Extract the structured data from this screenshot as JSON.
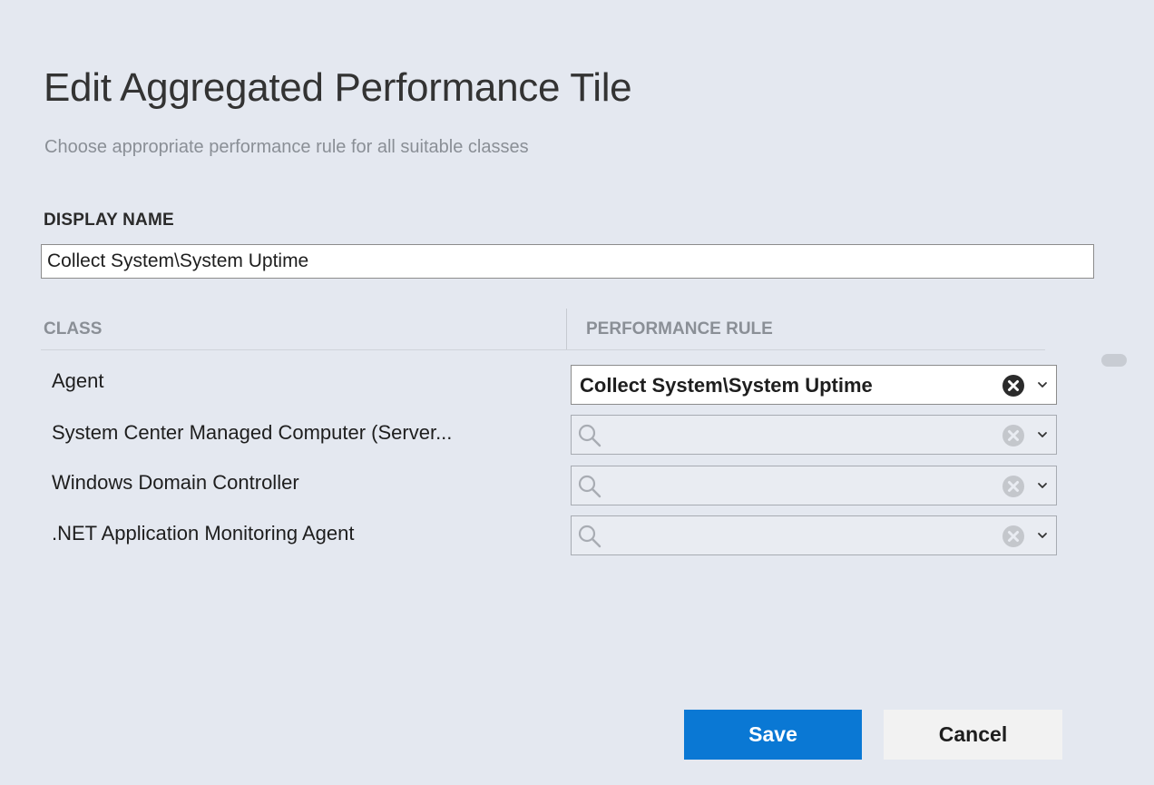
{
  "dialog": {
    "title": "Edit Aggregated Performance Tile",
    "subtitle": "Choose appropriate performance rule for all suitable classes"
  },
  "display_name": {
    "label": "DISPLAY NAME",
    "value": "Collect System\\System Uptime"
  },
  "table": {
    "col_class": "CLASS",
    "col_rule": "PERFORMANCE RULE",
    "rows": [
      {
        "class": "Agent",
        "rule": "Collect System\\System Uptime"
      },
      {
        "class": "System Center Managed Computer (Server...",
        "rule": ""
      },
      {
        "class": "Windows Domain Controller",
        "rule": ""
      },
      {
        "class": ".NET Application Monitoring Agent",
        "rule": ""
      }
    ]
  },
  "buttons": {
    "save": "Save",
    "cancel": "Cancel"
  },
  "colors": {
    "accent": "#0a78d4",
    "background": "#e4e8f0"
  }
}
